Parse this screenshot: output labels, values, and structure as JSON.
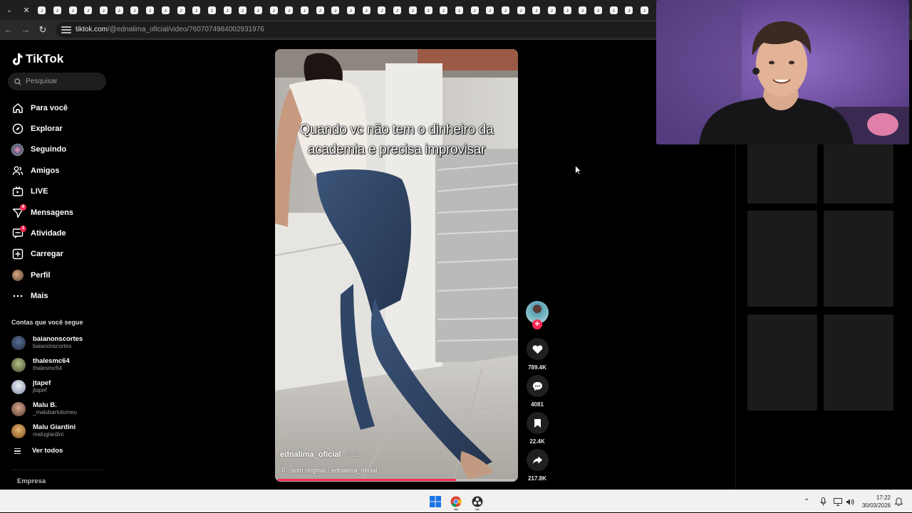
{
  "browser": {
    "tab_count": 40,
    "tab_favicon_glyph": "♪",
    "url_host": "tiktok.com",
    "url_path": "/@ednalima_oficial/video/7607074984002931976"
  },
  "sidebar": {
    "brand": "TikTok",
    "search_placeholder": "Pesquisar",
    "nav": [
      {
        "label": "Para você",
        "icon": "home-icon"
      },
      {
        "label": "Explorar",
        "icon": "compass-icon"
      },
      {
        "label": "Seguindo",
        "icon": "following-avatar-icon"
      },
      {
        "label": "Amigos",
        "icon": "friends-icon"
      },
      {
        "label": "LIVE",
        "icon": "live-tv-icon"
      },
      {
        "label": "Mensagens",
        "icon": "messages-icon",
        "badge": "6"
      },
      {
        "label": "Atividade",
        "icon": "activity-icon",
        "badge": "1"
      },
      {
        "label": "Carregar",
        "icon": "upload-icon"
      },
      {
        "label": "Perfil",
        "icon": "profile-avatar-icon"
      },
      {
        "label": "Mais",
        "icon": "more-icon"
      }
    ],
    "following_title": "Contas que você segue",
    "following": [
      {
        "name": "baianonscortes",
        "user": "baianonscortes",
        "color": "#3a4a66"
      },
      {
        "name": "thalesmc64",
        "user": "thalesmc64",
        "color": "#8b9a6a"
      },
      {
        "name": "jtapef",
        "user": "jtapef",
        "color": "#cfd6e6"
      },
      {
        "name": "Malu B.",
        "user": "_malubartolomeu",
        "color": "#b07f6a"
      },
      {
        "name": "Malu Giardini",
        "user": "malugiardini",
        "color": "#d39b4a"
      }
    ],
    "see_all": "Ver todos",
    "company": "Empresa"
  },
  "video": {
    "caption_line1": "Quando vc não tem  o  dinheiro da",
    "caption_line2": "academia e precisa improvisar",
    "author": "ednalima_oficial",
    "date": "· 2-15",
    "sound": "som original - ednalima_oficial",
    "progress": 0.75
  },
  "actions": {
    "likes": "789.4K",
    "comments": "4081",
    "saves": "22.4K",
    "shares": "217.8K"
  },
  "taskbar": {
    "time": "17:22",
    "date": "30/03/2026"
  },
  "colors": {
    "accent": "#fe2c55",
    "background": "#000000",
    "webcam_bg": "#6b4da0"
  }
}
